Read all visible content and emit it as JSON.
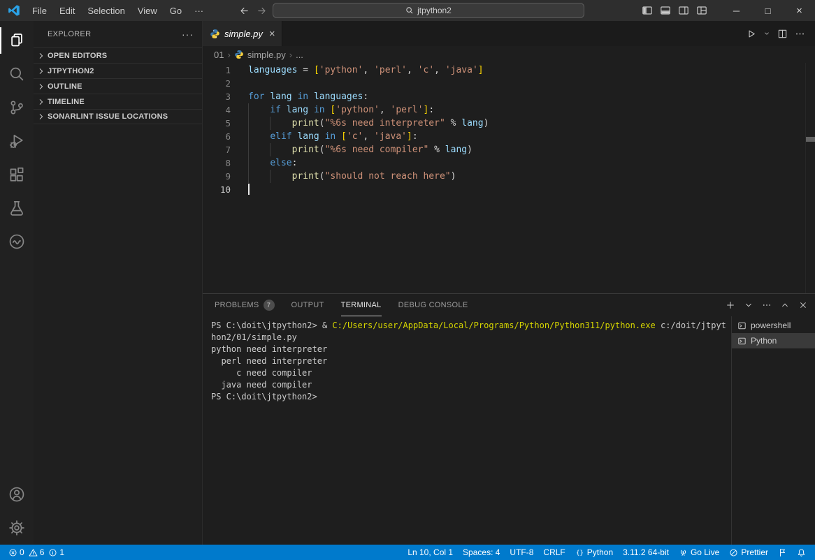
{
  "titlebar": {
    "menu": [
      "File",
      "Edit",
      "Selection",
      "View",
      "Go",
      "···"
    ],
    "search": {
      "value": "jtpython2"
    },
    "window_controls": {
      "minimize": "─",
      "maximize": "□",
      "close": "×"
    },
    "layout_buttons": [
      {
        "icon": "toggle-sidebar-icon",
        "id": "toggle-primary-sidebar"
      },
      {
        "icon": "toggle-panel-icon",
        "id": "toggle-panel"
      },
      {
        "icon": "toggle-secondary-sidebar-icon",
        "id": "toggle-secondary-sidebar"
      },
      {
        "icon": "customize-layout-icon",
        "id": "customize-layout"
      }
    ]
  },
  "activitybar": {
    "top": [
      {
        "icon": "files-icon",
        "id": "explorer",
        "active": true
      },
      {
        "icon": "search-icon",
        "id": "search"
      },
      {
        "icon": "source-control-icon",
        "id": "source-control"
      },
      {
        "icon": "run-debug-icon",
        "id": "run-and-debug"
      },
      {
        "icon": "extensions-icon",
        "id": "extensions"
      },
      {
        "icon": "testing-icon",
        "id": "testing"
      },
      {
        "icon": "sonarlint-icon",
        "id": "sonarlint"
      }
    ],
    "bottom": [
      {
        "icon": "account-icon",
        "id": "accounts"
      },
      {
        "icon": "settings-gear-icon",
        "id": "manage"
      }
    ]
  },
  "sidebar": {
    "title": "EXPLORER",
    "more": "···",
    "sections": [
      {
        "label": "OPEN EDITORS"
      },
      {
        "label": "JTPYTHON2"
      },
      {
        "label": "OUTLINE"
      },
      {
        "label": "TIMELINE"
      },
      {
        "label": "SONARLINT ISSUE LOCATIONS"
      }
    ]
  },
  "editor": {
    "tab": {
      "label": "simple.py",
      "close": "×",
      "icon": "python-icon"
    },
    "actions": [
      {
        "icon": "run-icon",
        "id": "run-python-file"
      },
      {
        "icon": "chevron-down-icon",
        "id": "run-dropdown",
        "small": true
      },
      {
        "icon": "split-editor-icon",
        "id": "split-editor"
      },
      {
        "icon": "more-icon",
        "id": "editor-more-actions"
      }
    ],
    "breadcrumb": {
      "folder": "01",
      "file": "simple.py",
      "symbol": "...",
      "separator": "›"
    },
    "code": {
      "lines": [
        {
          "n": "1",
          "t": [
            [
              "languages",
              "va"
            ],
            [
              " = ",
              "df"
            ],
            [
              "[",
              "br"
            ],
            [
              "'python'",
              "st"
            ],
            [
              ", ",
              "df"
            ],
            [
              "'perl'",
              "st"
            ],
            [
              ", ",
              "df"
            ],
            [
              "'c'",
              "st"
            ],
            [
              ", ",
              "df"
            ],
            [
              "'java'",
              "st"
            ],
            [
              "]",
              "br"
            ]
          ]
        },
        {
          "n": "2",
          "t": []
        },
        {
          "n": "3",
          "t": [
            [
              "for",
              "kw"
            ],
            [
              " ",
              "df"
            ],
            [
              "lang",
              "va"
            ],
            [
              " ",
              "df"
            ],
            [
              "in",
              "kw"
            ],
            [
              " ",
              "df"
            ],
            [
              "languages",
              "va"
            ],
            [
              ":",
              "df"
            ]
          ]
        },
        {
          "n": "4",
          "g": [
            0
          ],
          "t": [
            [
              "    ",
              "df"
            ],
            [
              "if",
              "kw"
            ],
            [
              " ",
              "df"
            ],
            [
              "lang",
              "va"
            ],
            [
              " ",
              "df"
            ],
            [
              "in",
              "kw"
            ],
            [
              " ",
              "df"
            ],
            [
              "[",
              "br"
            ],
            [
              "'python'",
              "st"
            ],
            [
              ", ",
              "df"
            ],
            [
              "'perl'",
              "st"
            ],
            [
              "]",
              "br"
            ],
            [
              ":",
              "df"
            ]
          ]
        },
        {
          "n": "5",
          "g": [
            0,
            4
          ],
          "t": [
            [
              "        ",
              "df"
            ],
            [
              "print",
              "fn"
            ],
            [
              "(",
              "df"
            ],
            [
              "\"%6s need interpreter\"",
              "st"
            ],
            [
              " % ",
              "df"
            ],
            [
              "lang",
              "va"
            ],
            [
              ")",
              "df"
            ]
          ]
        },
        {
          "n": "6",
          "g": [
            0
          ],
          "t": [
            [
              "    ",
              "df"
            ],
            [
              "elif",
              "kw"
            ],
            [
              " ",
              "df"
            ],
            [
              "lang",
              "va"
            ],
            [
              " ",
              "df"
            ],
            [
              "in",
              "kw"
            ],
            [
              " ",
              "df"
            ],
            [
              "[",
              "br"
            ],
            [
              "'c'",
              "st"
            ],
            [
              ", ",
              "df"
            ],
            [
              "'java'",
              "st"
            ],
            [
              "]",
              "br"
            ],
            [
              ":",
              "df"
            ]
          ]
        },
        {
          "n": "7",
          "g": [
            0,
            4
          ],
          "t": [
            [
              "        ",
              "df"
            ],
            [
              "print",
              "fn"
            ],
            [
              "(",
              "df"
            ],
            [
              "\"%6s need compiler\"",
              "st"
            ],
            [
              " % ",
              "df"
            ],
            [
              "lang",
              "va"
            ],
            [
              ")",
              "df"
            ]
          ]
        },
        {
          "n": "8",
          "g": [
            0
          ],
          "t": [
            [
              "    ",
              "df"
            ],
            [
              "else",
              "kw"
            ],
            [
              ":",
              "df"
            ]
          ]
        },
        {
          "n": "9",
          "g": [
            0,
            4
          ],
          "t": [
            [
              "        ",
              "df"
            ],
            [
              "print",
              "fn"
            ],
            [
              "(",
              "df"
            ],
            [
              "\"should not reach here\"",
              "st"
            ],
            [
              ")",
              "df"
            ]
          ]
        },
        {
          "n": "10",
          "a": true,
          "c": true,
          "t": []
        }
      ]
    }
  },
  "panel": {
    "tabs": [
      {
        "label": "PROBLEMS",
        "badge": "7"
      },
      {
        "label": "OUTPUT"
      },
      {
        "label": "TERMINAL",
        "active": true
      },
      {
        "label": "DEBUG CONSOLE"
      }
    ],
    "actions": [
      {
        "icon": "plus-icon",
        "id": "new-terminal"
      },
      {
        "icon": "chevron-down-icon",
        "id": "terminal-launch-dropdown"
      },
      {
        "icon": "more-icon",
        "id": "panel-more-actions"
      },
      {
        "icon": "chevron-up-icon",
        "id": "maximize-panel"
      },
      {
        "icon": "close-icon",
        "id": "close-panel"
      }
    ],
    "terminal": {
      "lines": [
        {
          "t": [
            [
              "PS C:\\doit\\jtpython2> & ",
              "d"
            ],
            [
              "C:/Users/user/AppData/Local/Programs/Python/Python311/python.exe",
              "y"
            ],
            [
              " c:/doit/jtpyt",
              "d"
            ]
          ]
        },
        {
          "t": [
            [
              "hon2/01/simple.py",
              "d"
            ]
          ]
        },
        {
          "t": [
            [
              "python need interpreter",
              "d"
            ]
          ]
        },
        {
          "t": [
            [
              "  perl need interpreter",
              "d"
            ]
          ]
        },
        {
          "t": [
            [
              "     c need compiler",
              "d"
            ]
          ]
        },
        {
          "t": [
            [
              "  java need compiler",
              "d"
            ]
          ]
        },
        {
          "t": [
            [
              "PS C:\\doit\\jtpython2>",
              "d"
            ]
          ]
        }
      ]
    },
    "terminals": [
      {
        "icon": "terminal-icon",
        "label": "powershell"
      },
      {
        "icon": "terminal-icon",
        "label": "Python",
        "selected": true
      }
    ]
  },
  "statusbar": {
    "problems": {
      "errors": "0",
      "warnings": "6",
      "infos": "1"
    },
    "right": [
      {
        "text": "Ln 10, Col 1",
        "id": "cursor-position"
      },
      {
        "text": "Spaces: 4",
        "id": "indentation"
      },
      {
        "text": "UTF-8",
        "id": "encoding"
      },
      {
        "text": "CRLF",
        "id": "eol"
      },
      {
        "icon": "braces-icon",
        "text": "Python",
        "id": "language-mode"
      },
      {
        "text": "3.11.2 64-bit",
        "id": "python-interpreter"
      },
      {
        "icon": "broadcast-icon",
        "text": "Go Live",
        "id": "go-live"
      },
      {
        "icon": "slash-circle-icon",
        "text": "Prettier",
        "id": "prettier"
      },
      {
        "icon": "feedback-icon",
        "text": "",
        "id": "feedback"
      },
      {
        "icon": "bell-icon",
        "text": "",
        "id": "notifications"
      }
    ]
  },
  "colors": {
    "statusbar_accent": "#007ACC",
    "tokens": {
      "kw": "#569CD6",
      "va": "#9CDCFE",
      "st": "#CE9178",
      "fn": "#DCDCAA",
      "br": "#FFD700",
      "df": "#D4D4D4",
      "d": "#CCCCCC",
      "y": "#D6D600"
    }
  }
}
